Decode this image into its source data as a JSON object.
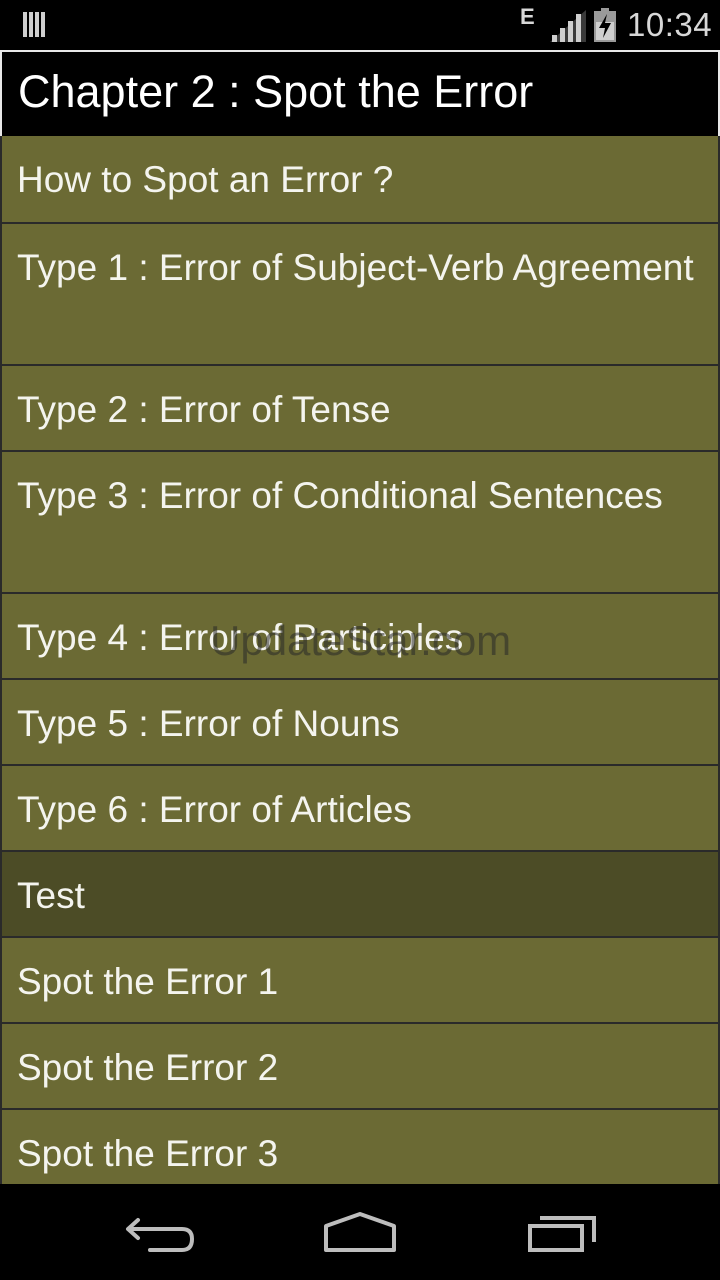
{
  "status_bar": {
    "network_type": "E",
    "time": "10:34",
    "icons": [
      "notification-bars-icon",
      "signal-icon",
      "battery-charging-icon"
    ]
  },
  "header": {
    "title": "Chapter 2 : Spot the Error"
  },
  "list": {
    "items": [
      {
        "label": "How to Spot an Error ?",
        "kind": "item"
      },
      {
        "label": "Type 1 : Error of Subject-Verb Agreement",
        "kind": "item"
      },
      {
        "label": "Type 2 : Error of Tense",
        "kind": "item"
      },
      {
        "label": "Type 3 : Error of Conditional Sentences",
        "kind": "item"
      },
      {
        "label": "Type 4 : Error of Participles",
        "kind": "item"
      },
      {
        "label": "Type 5 : Error of Nouns",
        "kind": "item"
      },
      {
        "label": "Type 6 : Error of Articles",
        "kind": "item"
      },
      {
        "label": "Test",
        "kind": "section-header"
      },
      {
        "label": "Spot the Error 1",
        "kind": "item"
      },
      {
        "label": "Spot the Error 2",
        "kind": "item"
      },
      {
        "label": "Spot the Error 3",
        "kind": "item"
      }
    ]
  },
  "watermark": "UpdateStar.com",
  "nav_bar": {
    "buttons": [
      "back-icon",
      "home-icon",
      "recent-apps-icon"
    ]
  },
  "colors": {
    "item_bg": "#6b6a34",
    "section_bg": "#4c4c26",
    "header_bg": "#000000",
    "text": "#f4f4ee"
  }
}
